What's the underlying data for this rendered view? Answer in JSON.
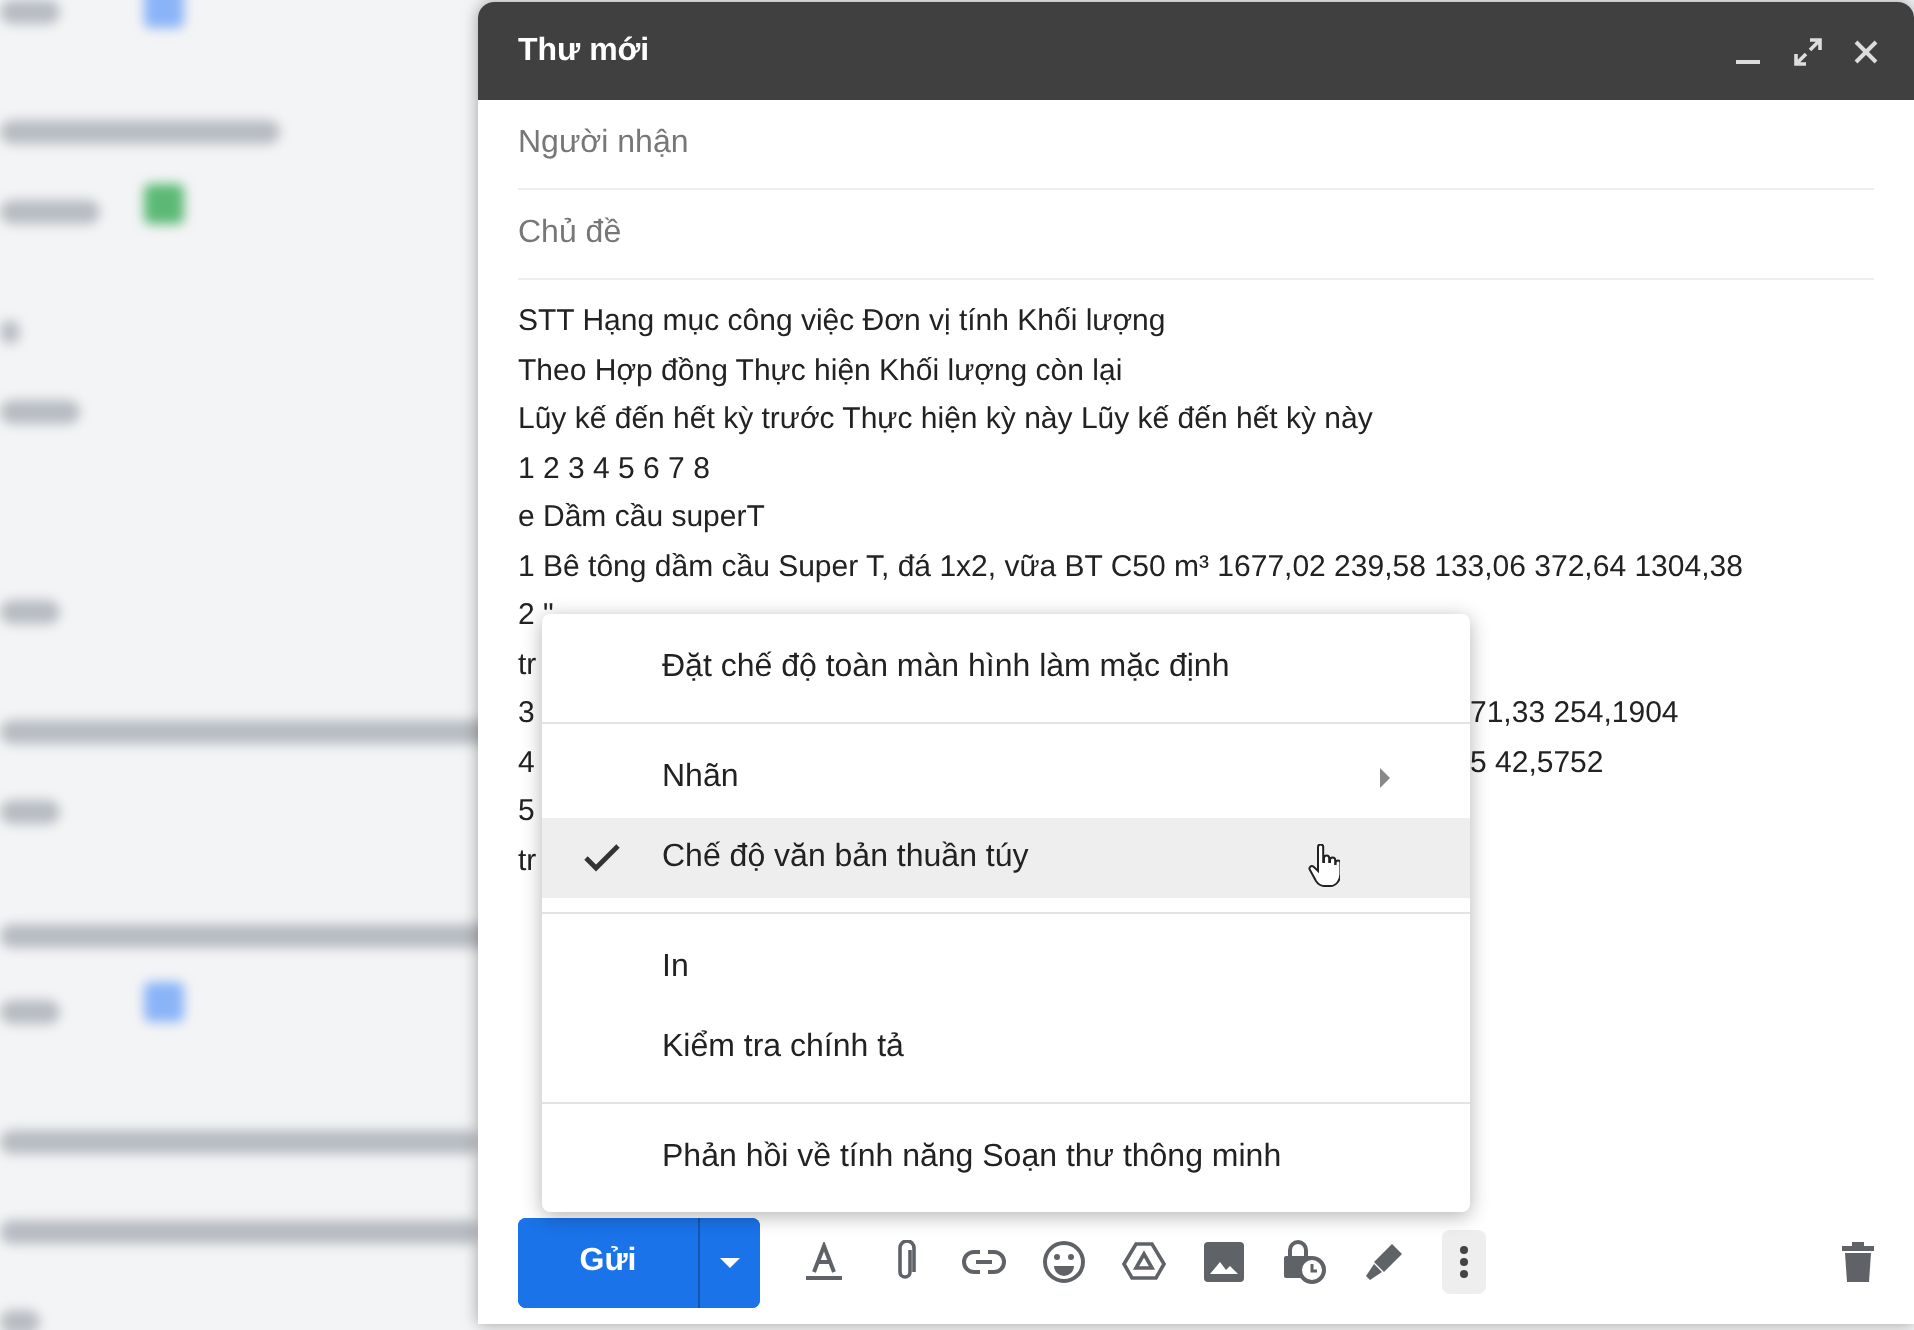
{
  "compose": {
    "title": "Thư mới",
    "recipients": {
      "placeholder": "Người nhận"
    },
    "subject": {
      "placeholder": "Chủ đề"
    },
    "body_lines": [
      {
        "text": "STT Hạng mục công việc Đơn vị tính Khối lượng"
      },
      {
        "text": "Theo Hợp đồng Thực hiện Khối lượng còn lại"
      },
      {
        "text": "Lũy kế đến hết kỳ trước Thực hiện kỳ này Lũy kế đến hết kỳ này"
      },
      {
        "text": "1 2 3 4 5 6 7 8"
      },
      {
        "text": "e Dầm cầu superT"
      },
      {
        "text": "1 Bê tông dầm cầu Super T, đá 1x2, vữa BT C50 m³ 1677,02 239,58 133,06 372,64 1304,38"
      },
      {
        "text": "2 \""
      },
      {
        "text": "tr"
      },
      {
        "text": "3",
        "right": "71,33 254,1904"
      },
      {
        "text": "4",
        "right": "5 42,5752"
      },
      {
        "text": "5"
      },
      {
        "text": "tr"
      }
    ],
    "send_label": "Gửi"
  },
  "menu": {
    "groups": [
      [
        {
          "label": "Đặt chế độ toàn màn hình làm mặc định",
          "checked": false,
          "submenu": false,
          "selected": false
        }
      ],
      [
        {
          "label": "Nhãn",
          "checked": false,
          "submenu": true,
          "selected": false
        },
        {
          "label": "Chế độ văn bản thuần túy",
          "checked": true,
          "submenu": false,
          "selected": true
        }
      ],
      [
        {
          "label": "In",
          "checked": false,
          "submenu": false,
          "selected": false
        },
        {
          "label": "Kiểm tra chính tả",
          "checked": false,
          "submenu": false,
          "selected": false
        }
      ],
      [
        {
          "label": "Phản hồi về tính năng Soạn thư thông minh",
          "checked": false,
          "submenu": false,
          "selected": false
        }
      ]
    ]
  }
}
